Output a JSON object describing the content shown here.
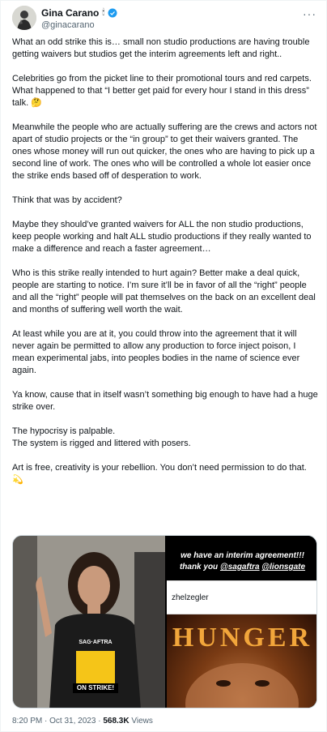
{
  "header": {
    "display_name": "Gina Carano",
    "torch_emoji": "🕯",
    "handle": "@ginacarano",
    "more_label": "···"
  },
  "tweet": {
    "paragraphs": [
      "What an odd strike this is… small non studio productions are having trouble getting waivers but studios get the interim agreements left and right..",
      "Celebrities go from the picket line to their promotional tours and red carpets. What happened to that “I better get paid for every hour I stand in this dress” talk. 🤔",
      "Meanwhile the people who are actually suffering are the crews and actors not apart of studio projects or the “in group” to get their waivers granted. The ones whose money will run out quicker, the ones who are having to pick up a second line of work. The ones who will be controlled a whole lot easier once the strike ends based off of desperation to work.",
      "Think that was by accident?",
      "Maybe they should’ve granted waivers for ALL the non studio productions, keep people working and halt ALL studio productions if they really wanted to make a difference and reach a faster agreement…",
      "Who is this strike really intended to hurt again? Better make a deal quick, people are starting to notice. I’m sure it’ll be in favor of all the “right” people and all the “right” people will pat themselves on the back on an excellent deal and months of suffering well worth the wait.",
      "At least while you are at it, you could throw into the agreement that it will never again be permitted to allow any production to force inject poison, I mean experimental jabs, into peoples bodies in the name of science ever again.",
      "Ya know, cause that in itself wasn’t something big enough to have had a huge strike over.",
      "The hypocrisy is palpable.\nThe system is rigged and littered with posers.",
      "Art is free, creativity is your rebellion. You don’t need permission to do that. 💫"
    ]
  },
  "media": {
    "shirt_line1": "SAG·AFTRA",
    "shirt_line2": "ON STRIKE!",
    "story_line1": "we have an interim agreement!!!",
    "story_line2_prefix": "thank you ",
    "story_mention1": "@sagaftra",
    "story_mention2": "@lionsgate",
    "zegler_text": "zhelzegler",
    "poster_title": "HUNGER"
  },
  "footer": {
    "time": "8:20 PM",
    "separator": "·",
    "date": "Oct 31, 2023",
    "views_count": "568.3K",
    "views_label": "Views"
  },
  "colors": {
    "text": "#0f1419",
    "muted": "#536471",
    "verified": "#1d9bf0",
    "poster_title": "#f2a63b"
  }
}
